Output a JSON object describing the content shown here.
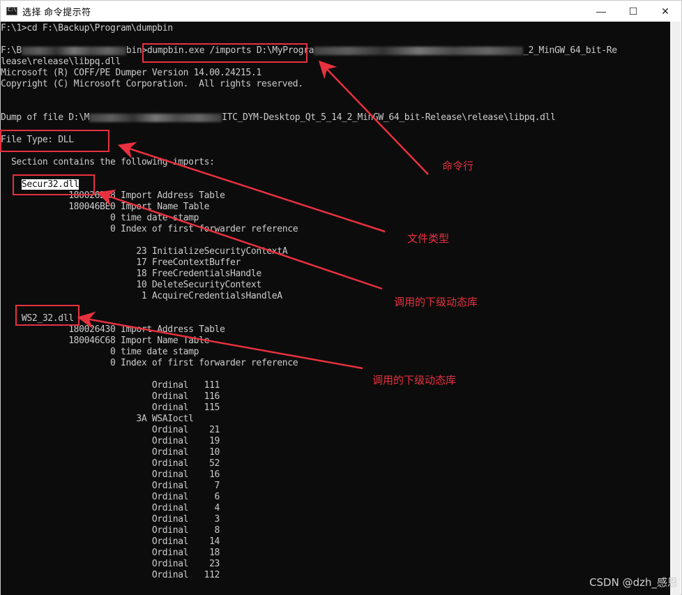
{
  "window": {
    "title": "选择 命令提示符",
    "minimize_glyph": "—",
    "maximize_glyph": "☐",
    "close_glyph": "✕"
  },
  "terminal": {
    "lines": [
      {
        "before": "F:\\1>cd F:\\Backup\\Program\\dumpbin",
        "blur": 0,
        "after": ""
      },
      {
        "before": "",
        "blur": 0,
        "after": ""
      },
      {
        "before": "F:\\B",
        "blur": 150,
        "after": "bin>dumpbin.exe /imports D:\\MyProgra",
        "blur2": 300,
        "after2": "_2_MinGW_64_bit-Re"
      },
      {
        "before": "lease\\release\\libpq.dll",
        "blur": 0,
        "after": ""
      },
      {
        "before": "Microsoft (R) COFF/PE Dumper Version 14.00.24215.1",
        "blur": 0,
        "after": ""
      },
      {
        "before": "Copyright (C) Microsoft Corporation.  All rights reserved.",
        "blur": 0,
        "after": ""
      },
      {
        "before": "",
        "blur": 0,
        "after": ""
      },
      {
        "before": "",
        "blur": 0,
        "after": ""
      },
      {
        "before": "Dump of file D:\\M",
        "blur": 190,
        "after": "ITC_DYM-Desktop_Qt_5_14_2_MinGW_64_bit-Release\\release\\libpq.dll"
      },
      {
        "before": "",
        "blur": 0,
        "after": ""
      },
      {
        "before": "File Type: DLL",
        "blur": 0,
        "after": ""
      },
      {
        "before": "",
        "blur": 0,
        "after": ""
      },
      {
        "before": "  Section contains the following imports:",
        "blur": 0,
        "after": ""
      },
      {
        "before": "",
        "blur": 0,
        "after": ""
      },
      {
        "before": "    ",
        "hl": "Secur32.dll",
        "blur": 0,
        "after": ""
      },
      {
        "before": "             1800262A8 Import Address Table",
        "blur": 0,
        "after": ""
      },
      {
        "before": "             180046BE0 Import Name Table",
        "blur": 0,
        "after": ""
      },
      {
        "before": "                     0 time date stamp",
        "blur": 0,
        "after": ""
      },
      {
        "before": "                     0 Index of first forwarder reference",
        "blur": 0,
        "after": ""
      },
      {
        "before": "",
        "blur": 0,
        "after": ""
      },
      {
        "before": "                          23 InitializeSecurityContextA",
        "blur": 0,
        "after": ""
      },
      {
        "before": "                          17 FreeContextBuffer",
        "blur": 0,
        "after": ""
      },
      {
        "before": "                          18 FreeCredentialsHandle",
        "blur": 0,
        "after": ""
      },
      {
        "before": "                          10 DeleteSecurityContext",
        "blur": 0,
        "after": ""
      },
      {
        "before": "                           1 AcquireCredentialsHandleA",
        "blur": 0,
        "after": ""
      },
      {
        "before": "",
        "blur": 0,
        "after": ""
      },
      {
        "before": "    WS2_32.dll",
        "blur": 0,
        "after": ""
      },
      {
        "before": "             180026430 Import Address Table",
        "blur": 0,
        "after": ""
      },
      {
        "before": "             180046C68 Import Name Table",
        "blur": 0,
        "after": ""
      },
      {
        "before": "                     0 time date stamp",
        "blur": 0,
        "after": ""
      },
      {
        "before": "                     0 Index of first forwarder reference",
        "blur": 0,
        "after": ""
      },
      {
        "before": "",
        "blur": 0,
        "after": ""
      },
      {
        "before": "                             Ordinal   111",
        "blur": 0,
        "after": ""
      },
      {
        "before": "                             Ordinal   116",
        "blur": 0,
        "after": ""
      },
      {
        "before": "                             Ordinal   115",
        "blur": 0,
        "after": ""
      },
      {
        "before": "                          3A WSAIoctl",
        "blur": 0,
        "after": ""
      },
      {
        "before": "                             Ordinal    21",
        "blur": 0,
        "after": ""
      },
      {
        "before": "                             Ordinal    19",
        "blur": 0,
        "after": ""
      },
      {
        "before": "                             Ordinal    10",
        "blur": 0,
        "after": ""
      },
      {
        "before": "                             Ordinal    52",
        "blur": 0,
        "after": ""
      },
      {
        "before": "                             Ordinal    16",
        "blur": 0,
        "after": ""
      },
      {
        "before": "                             Ordinal     7",
        "blur": 0,
        "after": ""
      },
      {
        "before": "                             Ordinal     6",
        "blur": 0,
        "after": ""
      },
      {
        "before": "                             Ordinal     4",
        "blur": 0,
        "after": ""
      },
      {
        "before": "                             Ordinal     3",
        "blur": 0,
        "after": ""
      },
      {
        "before": "                             Ordinal     8",
        "blur": 0,
        "after": ""
      },
      {
        "before": "                             Ordinal    14",
        "blur": 0,
        "after": ""
      },
      {
        "before": "                             Ordinal    18",
        "blur": 0,
        "after": ""
      },
      {
        "before": "                             Ordinal    23",
        "blur": 0,
        "after": ""
      },
      {
        "before": "                             Ordinal   112",
        "blur": 0,
        "after": ""
      }
    ]
  },
  "annotations": {
    "command_line": "命令行",
    "file_type": "文件类型",
    "dependency_1": "调用的下级动态库",
    "dependency_2": "调用的下级动态库",
    "color": "#e8313f"
  },
  "watermark": "CSDN @dzh_感恩"
}
